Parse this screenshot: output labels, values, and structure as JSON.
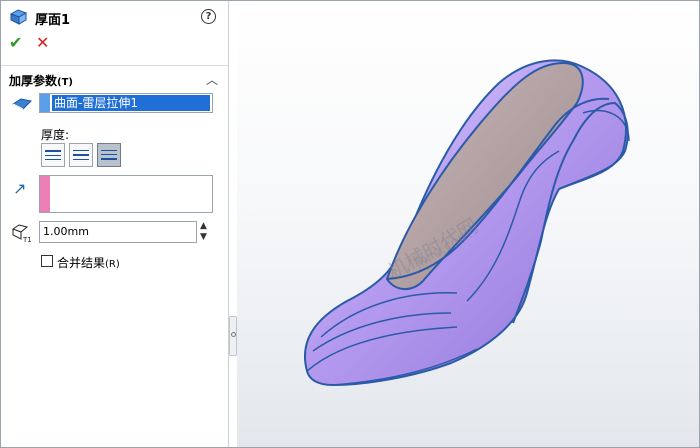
{
  "property_manager": {
    "title": "厚面1",
    "help_symbol": "?",
    "ok_symbol": "✔",
    "cancel_symbol": "✕",
    "section": {
      "title": "加厚参数",
      "shortcut": "(T)",
      "collapse_symbol": "︿"
    },
    "selected_faces": [
      "曲面-雷层拉伸1"
    ],
    "thickness_label": "厚度:",
    "thickness_sides": [
      "side-1",
      "both-sides",
      "side-2"
    ],
    "active_side": "side-2",
    "thickness_value": "1.00mm",
    "merge_result": {
      "label": "合并结果",
      "shortcut": "(R)",
      "checked": false
    }
  },
  "viewport": {
    "watermark_text": "机械时代网",
    "watermark_url": "jixie.com"
  },
  "colors": {
    "accept_green": "#2a9a2a",
    "cancel_red": "#d32020",
    "selection_blue": "#1f6fd6",
    "face_color": "#5aa0e8",
    "direction_color": "#ec7fb7",
    "shoe_purple": "#b69cf0",
    "shoe_edge": "#2b5aa8"
  }
}
